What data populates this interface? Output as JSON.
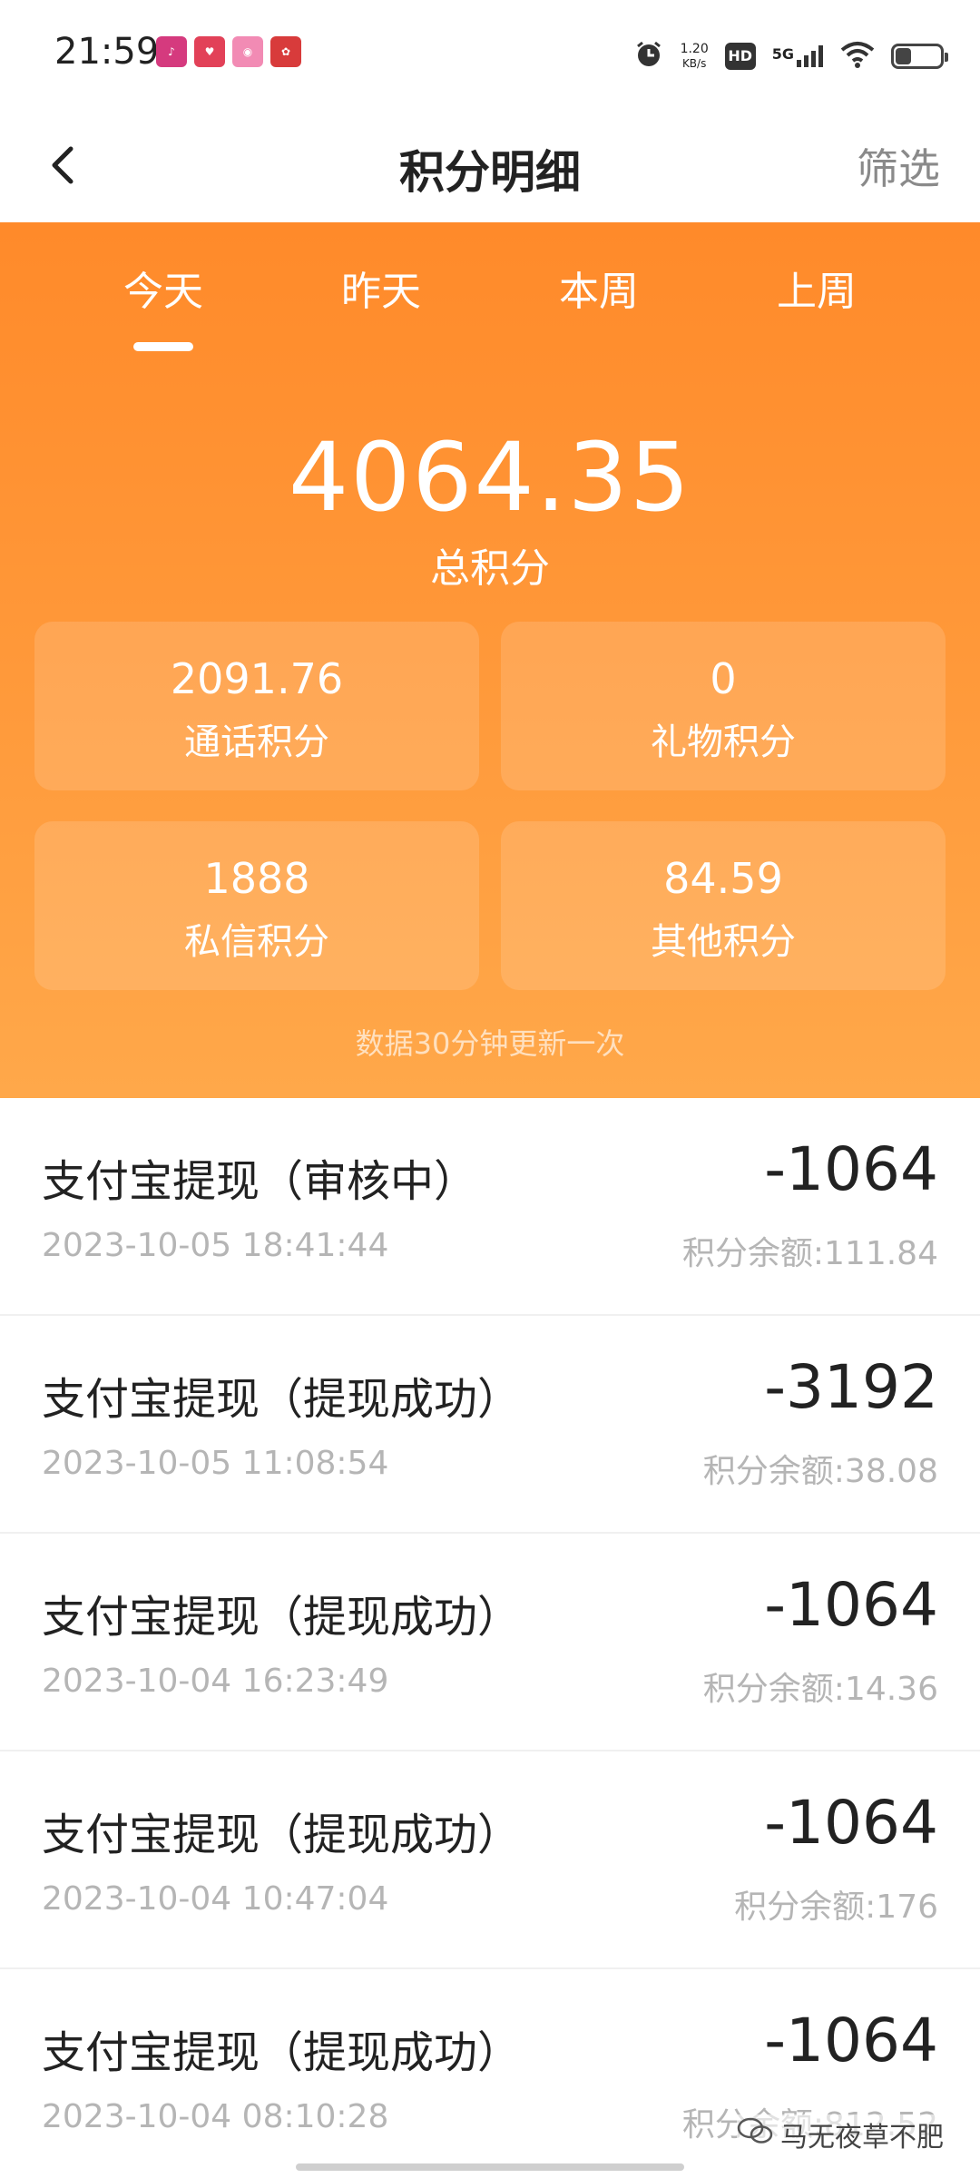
{
  "status_bar": {
    "time": "21:59",
    "net_speed_value": "1.20",
    "net_speed_unit": "KB/s",
    "hd": "HD",
    "network": "5G",
    "battery_level": 0.35,
    "app_icons": [
      {
        "name": "app-icon-1",
        "color": "#d53a7e"
      },
      {
        "name": "app-icon-2",
        "color": "#e24158"
      },
      {
        "name": "app-icon-3",
        "color": "#f28bb4"
      },
      {
        "name": "app-icon-4",
        "color": "#d83b3b"
      }
    ]
  },
  "header": {
    "title": "积分明细",
    "filter_label": "筛选"
  },
  "tabs": [
    {
      "label": "今天"
    },
    {
      "label": "昨天"
    },
    {
      "label": "本周"
    },
    {
      "label": "上周"
    }
  ],
  "summary": {
    "total_value": "4064.35",
    "total_label": "总积分",
    "update_note": "数据30分钟更新一次",
    "cards": [
      {
        "value": "2091.76",
        "label": "通话积分"
      },
      {
        "value": "0",
        "label": "礼物积分"
      },
      {
        "value": "1888",
        "label": "私信积分"
      },
      {
        "value": "84.59",
        "label": "其他积分"
      }
    ]
  },
  "records": [
    {
      "title": "支付宝提现（审核中）",
      "time": "2023-10-05 18:41:44",
      "amount": "-1064",
      "balance": "积分余额:111.84"
    },
    {
      "title": "支付宝提现（提现成功）",
      "time": "2023-10-05 11:08:54",
      "amount": "-3192",
      "balance": "积分余额:38.08"
    },
    {
      "title": "支付宝提现（提现成功）",
      "time": "2023-10-04 16:23:49",
      "amount": "-1064",
      "balance": "积分余额:14.36"
    },
    {
      "title": "支付宝提现（提现成功）",
      "time": "2023-10-04 10:47:04",
      "amount": "-1064",
      "balance": "积分余额:176"
    },
    {
      "title": "支付宝提现（提现成功）",
      "time": "2023-10-04 08:10:28",
      "amount": "-1064",
      "balance": "积分余额:812.52"
    }
  ],
  "watermark": {
    "text": "马无夜草不肥"
  },
  "colors": {
    "accent_orange": "#ff8a2a",
    "text_primary": "#222222",
    "text_secondary": "#b5b5b5"
  }
}
